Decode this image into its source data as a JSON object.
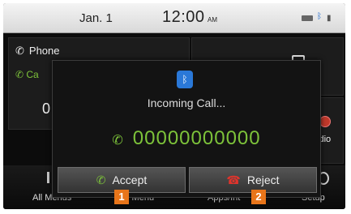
{
  "status_bar": {
    "date": "Jan. 1",
    "time": "12:00",
    "ampm": "AM"
  },
  "home": {
    "phone_tile": {
      "title": "Phone",
      "contacts_fragment": "Ca",
      "number_fragment": "0"
    },
    "audio_tile": {
      "label": "Audio"
    },
    "bottom_menu": {
      "all_menus": "All Menus",
      "my_menu": "y Menu",
      "apps": "Apps/Int",
      "setup": "Setup"
    }
  },
  "popup": {
    "title": "Incoming Call...",
    "caller_number": "00000000000",
    "accept_label": "Accept",
    "reject_label": "Reject"
  },
  "callouts": {
    "accept_marker": "1",
    "reject_marker": "2"
  },
  "icons": {
    "phone": "phone-handset-icon",
    "bluetooth": "bluetooth-icon",
    "caller": "incoming-call-icon",
    "accept": "accept-call-icon",
    "reject": "reject-call-icon"
  },
  "colors": {
    "accent_green": "#7dc33a",
    "reject_red": "#e0342c",
    "callout_orange": "#e8751a",
    "bluetooth_blue": "#2a78d8"
  }
}
